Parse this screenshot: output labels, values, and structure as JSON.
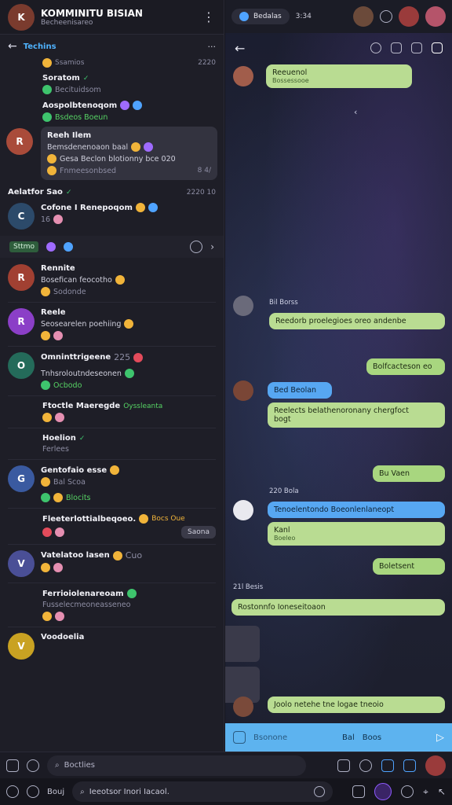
{
  "left_header": {
    "title": "KOMMINITU BISIAN",
    "subtitle": "Becheenisareo",
    "avatar": "K"
  },
  "subheader": {
    "label": "Techins"
  },
  "chats": [
    {
      "name": "",
      "time": "2220",
      "line": "Ssamios",
      "avatar": ""
    },
    {
      "name": "Soratom",
      "time": "",
      "line": "Becituidsom",
      "avatar": ""
    },
    {
      "name": "Aospolbtenoqom",
      "time": "",
      "line": "Bsdeos Boeun",
      "avatar": ""
    },
    {
      "name": "Reeh Ilem",
      "time": "",
      "line": "Bemsdenenoaon baal",
      "line2": "Gesa Beclon blotionny bce 020",
      "line3": "Fnmeesonbsed",
      "time2": "8 4/",
      "avatar": "R"
    },
    {
      "name": "Aelatfor Sao",
      "time": "2220 10",
      "line": "",
      "avatar": ""
    },
    {
      "name": "Cofone I Renepoqom",
      "time": "",
      "line": "16",
      "avatar": "C"
    },
    {
      "name": "Rennite",
      "time": "",
      "line": "Bosefican feocotho",
      "line2": "Sodonde",
      "avatar": "R"
    },
    {
      "name": "Reele",
      "time": "",
      "line": "Seosearelen poehiing",
      "avatar": "R"
    },
    {
      "name": "Omninttrigeene",
      "time": "225",
      "line": "Tnhsroloutndeseonen",
      "line2": "Ocbodo",
      "avatar": "O"
    },
    {
      "name": "Ftoctle Maeregde",
      "time": "",
      "line": "Oyssleanta",
      "avatar": ""
    },
    {
      "name": "Hoelion",
      "time": "",
      "line": "Ferlees",
      "avatar": ""
    },
    {
      "name": "Gentofaio esse",
      "time": "",
      "line": "Bal Scoa",
      "line2": "Blocits",
      "avatar": "G"
    },
    {
      "name": "Fleeterlottialbeqoeo.",
      "time": "",
      "line": "Bocs Oue",
      "button": "Saona",
      "avatar": ""
    },
    {
      "name": "Vatelatoo lasen",
      "time": "",
      "line": "Cuo",
      "avatar": "V"
    },
    {
      "name": "Ferrioiolenareoam",
      "time": "",
      "line": "Fusselecmeoneasseneo",
      "avatar": ""
    },
    {
      "name": "Voodoelia",
      "time": "",
      "line": "",
      "avatar": "V"
    }
  ],
  "toolrow": {
    "chip": "Sttmo"
  },
  "right_topbar": {
    "pill": "Bedalas",
    "count": "3:34"
  },
  "messages": [
    {
      "text": "Reeuenol",
      "sub": "Bossessooe"
    },
    {
      "day": "Bil Borss"
    },
    {
      "text": "Reedorb proelegioes oreo andenbe"
    },
    {
      "text": "Bolfcacteson eo"
    },
    {
      "text": "Bed Beolan",
      "blue": true
    },
    {
      "text": "Reelects belathenoronany chergfoct",
      "text2": "bogt"
    },
    {
      "text": "Bu Vaen"
    },
    {
      "day": "220 Bola"
    },
    {
      "text": "Tenoelentondo Boeonlenlaneopt",
      "blue": true
    },
    {
      "text": "Kanl",
      "sub": "Boeleo"
    },
    {
      "text": "Boletsent"
    },
    {
      "day": "21l Besis"
    },
    {
      "text": "Rostonnfo Ioneseitoaon"
    },
    {
      "text": "Joolo netehe tne logae tneoio"
    }
  ],
  "right_input": {
    "placeholder": "Bsonone",
    "label1": "Bal",
    "label2": "Boos"
  },
  "bar1": {
    "search_placeholder": "Boctlies"
  },
  "bar2": {
    "field_text": "Ieeotsor Inori Iacaol.",
    "left_label": "Bouj"
  }
}
